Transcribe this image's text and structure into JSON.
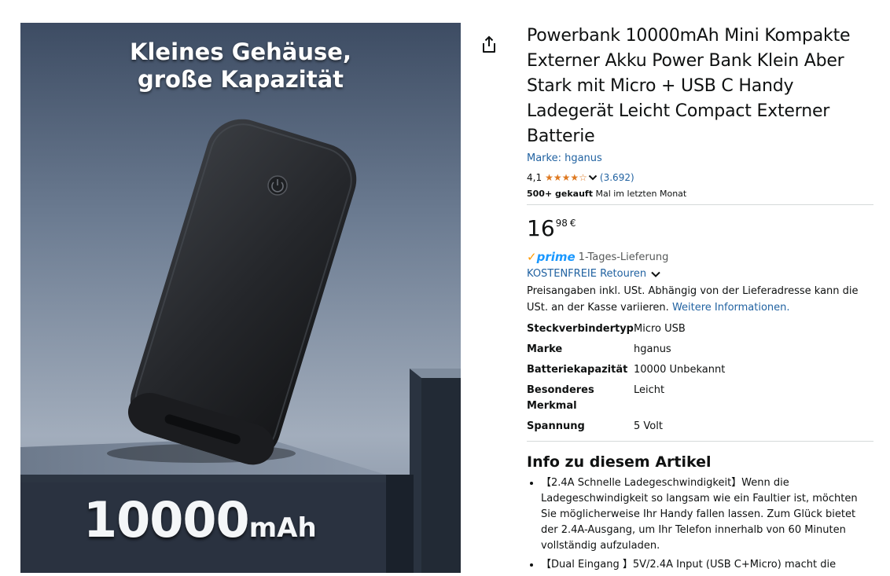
{
  "image": {
    "headline_line1": "Kleines Gehäuse,",
    "headline_line2": "große Kapazität",
    "capacity_number": "10000",
    "capacity_unit": "mAh"
  },
  "share": {
    "icon": "share-icon"
  },
  "product": {
    "title": "Powerbank 10000mAh Mini Kompakte Externer Akku Power Bank Klein Aber Stark mit Micro + USB C Handy Ladegerät Leicht Compact Externer Batterie",
    "brand_link": "Marke: hganus",
    "rating": "4,1",
    "rating_value": 4.1,
    "rating_count": "(3.692)",
    "bought_bold": "500+ gekauft",
    "bought_rest": "Mal im letzten Monat",
    "price_whole": "16",
    "price_fraction": "98",
    "price_currency": "€",
    "prime_label": "prime",
    "delivery": "1-Tages-Lieferung",
    "returns": "KOSTENFREIE Retouren",
    "tax_note": "Preisangaben inkl. USt. Abhängig von der Lieferadresse kann die USt. an der Kasse variieren.",
    "tax_link": "Weitere Informationen.",
    "specs": [
      {
        "key": "Steckverbindertyp",
        "value": "Micro USB"
      },
      {
        "key": "Marke",
        "value": "hganus"
      },
      {
        "key": "Batteriekapazität",
        "value": "10000 Unbekannt"
      },
      {
        "key": "Besonderes Merkmal",
        "value": "Leicht"
      },
      {
        "key": "Spannung",
        "value": "5 Volt"
      }
    ],
    "info_heading": "Info zu diesem Artikel",
    "bullets": [
      "【2.4A Schnelle Ladegeschwindigkeit】Wenn die Ladegeschwindigkeit so langsam wie ein Faultier ist, möchten Sie möglicherweise Ihr Handy fallen lassen. Zum Glück bietet der 2.4A-Ausgang, um Ihr Telefon innerhalb von 60 Minuten vollständig aufzuladen.",
      "【Dual Eingang 】5V/2.4A Input (USB C+Micro) macht die"
    ]
  },
  "colors": {
    "link": "#2162a1",
    "star": "#de7921",
    "prime_blue": "#1a98ff",
    "prime_check": "#ff9900"
  }
}
